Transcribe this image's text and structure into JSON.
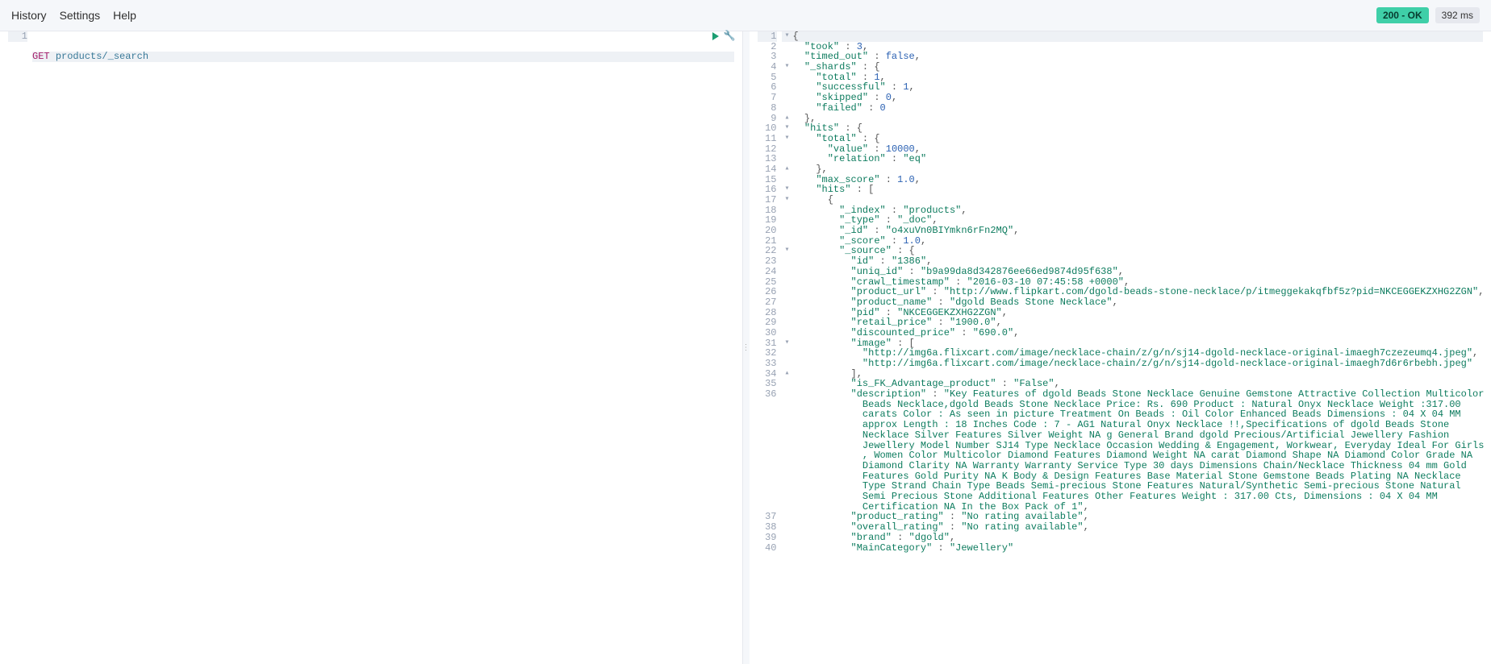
{
  "toolbar": {
    "history": "History",
    "settings": "Settings",
    "help": "Help",
    "status": "200 - OK",
    "time": "392 ms"
  },
  "request": {
    "lines": [
      "1"
    ],
    "method": "GET",
    "path": "products/_search"
  },
  "response": {
    "lines": [
      {
        "n": "1",
        "f": "▾",
        "t": [
          {
            "c": "pun",
            "v": "{"
          }
        ]
      },
      {
        "n": "2",
        "t": [
          {
            "c": "",
            "v": "  "
          },
          {
            "c": "tok-k",
            "v": "\"took\""
          },
          {
            "c": "pun",
            "v": " : "
          },
          {
            "c": "tok-n",
            "v": "3"
          },
          {
            "c": "pun",
            "v": ","
          }
        ]
      },
      {
        "n": "3",
        "t": [
          {
            "c": "",
            "v": "  "
          },
          {
            "c": "tok-k",
            "v": "\"timed_out\""
          },
          {
            "c": "pun",
            "v": " : "
          },
          {
            "c": "tok-b",
            "v": "false"
          },
          {
            "c": "pun",
            "v": ","
          }
        ]
      },
      {
        "n": "4",
        "f": "▾",
        "t": [
          {
            "c": "",
            "v": "  "
          },
          {
            "c": "tok-k",
            "v": "\"_shards\""
          },
          {
            "c": "pun",
            "v": " : {"
          }
        ]
      },
      {
        "n": "5",
        "t": [
          {
            "c": "",
            "v": "    "
          },
          {
            "c": "tok-k",
            "v": "\"total\""
          },
          {
            "c": "pun",
            "v": " : "
          },
          {
            "c": "tok-n",
            "v": "1"
          },
          {
            "c": "pun",
            "v": ","
          }
        ]
      },
      {
        "n": "6",
        "t": [
          {
            "c": "",
            "v": "    "
          },
          {
            "c": "tok-k",
            "v": "\"successful\""
          },
          {
            "c": "pun",
            "v": " : "
          },
          {
            "c": "tok-n",
            "v": "1"
          },
          {
            "c": "pun",
            "v": ","
          }
        ]
      },
      {
        "n": "7",
        "t": [
          {
            "c": "",
            "v": "    "
          },
          {
            "c": "tok-k",
            "v": "\"skipped\""
          },
          {
            "c": "pun",
            "v": " : "
          },
          {
            "c": "tok-n",
            "v": "0"
          },
          {
            "c": "pun",
            "v": ","
          }
        ]
      },
      {
        "n": "8",
        "t": [
          {
            "c": "",
            "v": "    "
          },
          {
            "c": "tok-k",
            "v": "\"failed\""
          },
          {
            "c": "pun",
            "v": " : "
          },
          {
            "c": "tok-n",
            "v": "0"
          }
        ]
      },
      {
        "n": "9",
        "f": "▴",
        "t": [
          {
            "c": "",
            "v": "  "
          },
          {
            "c": "pun",
            "v": "},"
          }
        ]
      },
      {
        "n": "10",
        "f": "▾",
        "t": [
          {
            "c": "",
            "v": "  "
          },
          {
            "c": "tok-k",
            "v": "\"hits\""
          },
          {
            "c": "pun",
            "v": " : {"
          }
        ]
      },
      {
        "n": "11",
        "f": "▾",
        "t": [
          {
            "c": "",
            "v": "    "
          },
          {
            "c": "tok-k",
            "v": "\"total\""
          },
          {
            "c": "pun",
            "v": " : {"
          }
        ]
      },
      {
        "n": "12",
        "t": [
          {
            "c": "",
            "v": "      "
          },
          {
            "c": "tok-k",
            "v": "\"value\""
          },
          {
            "c": "pun",
            "v": " : "
          },
          {
            "c": "tok-n",
            "v": "10000"
          },
          {
            "c": "pun",
            "v": ","
          }
        ]
      },
      {
        "n": "13",
        "t": [
          {
            "c": "",
            "v": "      "
          },
          {
            "c": "tok-k",
            "v": "\"relation\""
          },
          {
            "c": "pun",
            "v": " : "
          },
          {
            "c": "tok-s",
            "v": "\"eq\""
          }
        ]
      },
      {
        "n": "14",
        "f": "▴",
        "t": [
          {
            "c": "",
            "v": "    "
          },
          {
            "c": "pun",
            "v": "},"
          }
        ]
      },
      {
        "n": "15",
        "t": [
          {
            "c": "",
            "v": "    "
          },
          {
            "c": "tok-k",
            "v": "\"max_score\""
          },
          {
            "c": "pun",
            "v": " : "
          },
          {
            "c": "tok-n",
            "v": "1.0"
          },
          {
            "c": "pun",
            "v": ","
          }
        ]
      },
      {
        "n": "16",
        "f": "▾",
        "t": [
          {
            "c": "",
            "v": "    "
          },
          {
            "c": "tok-k",
            "v": "\"hits\""
          },
          {
            "c": "pun",
            "v": " : ["
          }
        ]
      },
      {
        "n": "17",
        "f": "▾",
        "t": [
          {
            "c": "",
            "v": "      "
          },
          {
            "c": "pun",
            "v": "{"
          }
        ]
      },
      {
        "n": "18",
        "t": [
          {
            "c": "",
            "v": "        "
          },
          {
            "c": "tok-k",
            "v": "\"_index\""
          },
          {
            "c": "pun",
            "v": " : "
          },
          {
            "c": "tok-s",
            "v": "\"products\""
          },
          {
            "c": "pun",
            "v": ","
          }
        ]
      },
      {
        "n": "19",
        "t": [
          {
            "c": "",
            "v": "        "
          },
          {
            "c": "tok-k",
            "v": "\"_type\""
          },
          {
            "c": "pun",
            "v": " : "
          },
          {
            "c": "tok-s",
            "v": "\"_doc\""
          },
          {
            "c": "pun",
            "v": ","
          }
        ]
      },
      {
        "n": "20",
        "t": [
          {
            "c": "",
            "v": "        "
          },
          {
            "c": "tok-k",
            "v": "\"_id\""
          },
          {
            "c": "pun",
            "v": " : "
          },
          {
            "c": "tok-s",
            "v": "\"o4xuVn0BIYmkn6rFn2MQ\""
          },
          {
            "c": "pun",
            "v": ","
          }
        ]
      },
      {
        "n": "21",
        "t": [
          {
            "c": "",
            "v": "        "
          },
          {
            "c": "tok-k",
            "v": "\"_score\""
          },
          {
            "c": "pun",
            "v": " : "
          },
          {
            "c": "tok-n",
            "v": "1.0"
          },
          {
            "c": "pun",
            "v": ","
          }
        ]
      },
      {
        "n": "22",
        "f": "▾",
        "t": [
          {
            "c": "",
            "v": "        "
          },
          {
            "c": "tok-k",
            "v": "\"_source\""
          },
          {
            "c": "pun",
            "v": " : {"
          }
        ]
      },
      {
        "n": "23",
        "t": [
          {
            "c": "",
            "v": "          "
          },
          {
            "c": "tok-k",
            "v": "\"id\""
          },
          {
            "c": "pun",
            "v": " : "
          },
          {
            "c": "tok-s",
            "v": "\"1386\""
          },
          {
            "c": "pun",
            "v": ","
          }
        ]
      },
      {
        "n": "24",
        "t": [
          {
            "c": "",
            "v": "          "
          },
          {
            "c": "tok-k",
            "v": "\"uniq_id\""
          },
          {
            "c": "pun",
            "v": " : "
          },
          {
            "c": "tok-s",
            "v": "\"b9a99da8d342876ee66ed9874d95f638\""
          },
          {
            "c": "pun",
            "v": ","
          }
        ]
      },
      {
        "n": "25",
        "t": [
          {
            "c": "",
            "v": "          "
          },
          {
            "c": "tok-k",
            "v": "\"crawl_timestamp\""
          },
          {
            "c": "pun",
            "v": " : "
          },
          {
            "c": "tok-s",
            "v": "\"2016-03-10 07:45:58 +0000\""
          },
          {
            "c": "pun",
            "v": ","
          }
        ]
      },
      {
        "n": "26",
        "t": [
          {
            "c": "",
            "v": "          "
          },
          {
            "c": "tok-k",
            "v": "\"product_url\""
          },
          {
            "c": "pun",
            "v": " : "
          },
          {
            "c": "tok-s",
            "v": "\"http://www.flipkart.com/dgold-beads-stone-necklace/p/itmeggekakqfbf5z?pid=NKCEGGEKZXHG2ZGN\""
          },
          {
            "c": "pun",
            "v": ","
          }
        ]
      },
      {
        "n": "27",
        "t": [
          {
            "c": "",
            "v": "          "
          },
          {
            "c": "tok-k",
            "v": "\"product_name\""
          },
          {
            "c": "pun",
            "v": " : "
          },
          {
            "c": "tok-s",
            "v": "\"dgold Beads Stone Necklace\""
          },
          {
            "c": "pun",
            "v": ","
          }
        ]
      },
      {
        "n": "28",
        "t": [
          {
            "c": "",
            "v": "          "
          },
          {
            "c": "tok-k",
            "v": "\"pid\""
          },
          {
            "c": "pun",
            "v": " : "
          },
          {
            "c": "tok-s",
            "v": "\"NKCEGGEKZXHG2ZGN\""
          },
          {
            "c": "pun",
            "v": ","
          }
        ]
      },
      {
        "n": "29",
        "t": [
          {
            "c": "",
            "v": "          "
          },
          {
            "c": "tok-k",
            "v": "\"retail_price\""
          },
          {
            "c": "pun",
            "v": " : "
          },
          {
            "c": "tok-s",
            "v": "\"1900.0\""
          },
          {
            "c": "pun",
            "v": ","
          }
        ]
      },
      {
        "n": "30",
        "t": [
          {
            "c": "",
            "v": "          "
          },
          {
            "c": "tok-k",
            "v": "\"discounted_price\""
          },
          {
            "c": "pun",
            "v": " : "
          },
          {
            "c": "tok-s",
            "v": "\"690.0\""
          },
          {
            "c": "pun",
            "v": ","
          }
        ]
      },
      {
        "n": "31",
        "f": "▾",
        "t": [
          {
            "c": "",
            "v": "          "
          },
          {
            "c": "tok-k",
            "v": "\"image\""
          },
          {
            "c": "pun",
            "v": " : ["
          }
        ]
      },
      {
        "n": "32",
        "t": [
          {
            "c": "",
            "v": "            "
          },
          {
            "c": "tok-s",
            "v": "\"http://img6a.flixcart.com/image/necklace-chain/z/g/n/sj14-dgold-necklace-original-imaegh7czezeumq4.jpeg\""
          },
          {
            "c": "pun",
            "v": ","
          }
        ]
      },
      {
        "n": "33",
        "t": [
          {
            "c": "",
            "v": "            "
          },
          {
            "c": "tok-s",
            "v": "\"http://img6a.flixcart.com/image/necklace-chain/z/g/n/sj14-dgold-necklace-original-imaegh7d6r6rbebh.jpeg\""
          }
        ]
      },
      {
        "n": "34",
        "f": "▴",
        "t": [
          {
            "c": "",
            "v": "          "
          },
          {
            "c": "pun",
            "v": "],"
          }
        ]
      },
      {
        "n": "35",
        "t": [
          {
            "c": "",
            "v": "          "
          },
          {
            "c": "tok-k",
            "v": "\"is_FK_Advantage_product\""
          },
          {
            "c": "pun",
            "v": " : "
          },
          {
            "c": "tok-s",
            "v": "\"False\""
          },
          {
            "c": "pun",
            "v": ","
          }
        ]
      },
      {
        "n": "36",
        "t": [
          {
            "c": "",
            "v": "          "
          },
          {
            "c": "tok-k",
            "v": "\"description\""
          },
          {
            "c": "pun",
            "v": " : "
          },
          {
            "c": "tok-s",
            "v": "\"Key Features of dgold Beads Stone Necklace Genuine Gemstone Attractive Collection Multicolor\n            Beads Necklace,dgold Beads Stone Necklace Price: Rs. 690 Product : Natural Onyx Necklace Weight :317.00\n            carats Color : As seen in picture Treatment On Beads : Oil Color Enhanced Beads Dimensions : 04 X 04 MM\n            approx Length : 18 Inches Code : 7 - AG1 Natural Onyx Necklace !!,Specifications of dgold Beads Stone\n            Necklace Silver Features Silver Weight NA g General Brand dgold Precious/Artificial Jewellery Fashion\n            Jewellery Model Number SJ14 Type Necklace Occasion Wedding & Engagement, Workwear, Everyday Ideal For Girls\n            , Women Color Multicolor Diamond Features Diamond Weight NA carat Diamond Shape NA Diamond Color Grade NA\n            Diamond Clarity NA Warranty Warranty Service Type 30 days Dimensions Chain/Necklace Thickness 04 mm Gold\n            Features Gold Purity NA K Body & Design Features Base Material Stone Gemstone Beads Plating NA Necklace\n            Type Strand Chain Type Beads Semi-precious Stone Features Natural/Synthetic Semi-precious Stone Natural\n            Semi Precious Stone Additional Features Other Features Weight : 317.00 Cts, Dimensions : 04 X 04 MM\n            Certification NA In the Box Pack of 1\""
          },
          {
            "c": "pun",
            "v": ","
          }
        ]
      },
      {
        "n": "37",
        "t": [
          {
            "c": "",
            "v": "          "
          },
          {
            "c": "tok-k",
            "v": "\"product_rating\""
          },
          {
            "c": "pun",
            "v": " : "
          },
          {
            "c": "tok-s",
            "v": "\"No rating available\""
          },
          {
            "c": "pun",
            "v": ","
          }
        ]
      },
      {
        "n": "38",
        "t": [
          {
            "c": "",
            "v": "          "
          },
          {
            "c": "tok-k",
            "v": "\"overall_rating\""
          },
          {
            "c": "pun",
            "v": " : "
          },
          {
            "c": "tok-s",
            "v": "\"No rating available\""
          },
          {
            "c": "pun",
            "v": ","
          }
        ]
      },
      {
        "n": "39",
        "t": [
          {
            "c": "",
            "v": "          "
          },
          {
            "c": "tok-k",
            "v": "\"brand\""
          },
          {
            "c": "pun",
            "v": " : "
          },
          {
            "c": "tok-s",
            "v": "\"dgold\""
          },
          {
            "c": "pun",
            "v": ","
          }
        ]
      },
      {
        "n": "40",
        "t": [
          {
            "c": "",
            "v": "          "
          },
          {
            "c": "tok-k",
            "v": "\"MainCategory\""
          },
          {
            "c": "pun",
            "v": " : "
          },
          {
            "c": "tok-s",
            "v": "\"Jewellery\""
          }
        ]
      }
    ]
  }
}
